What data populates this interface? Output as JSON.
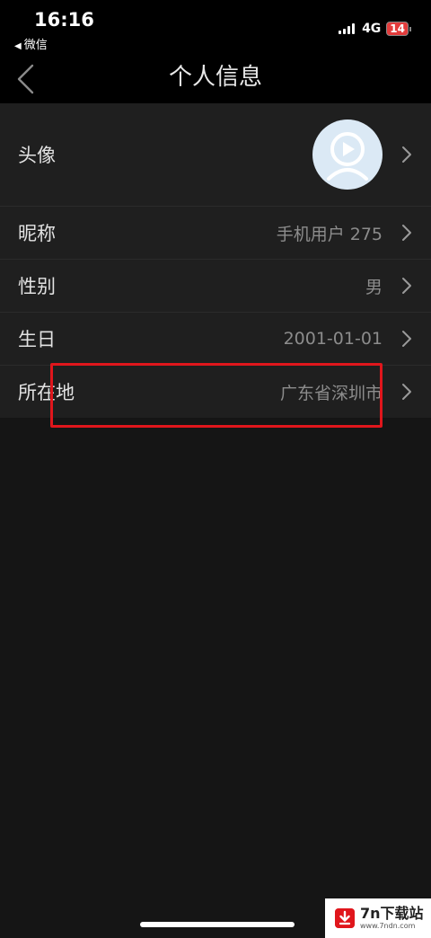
{
  "status_bar": {
    "time": "16:16",
    "back_app": "微信",
    "network": "4G",
    "battery": "14"
  },
  "nav": {
    "title": "个人信息"
  },
  "profile": {
    "avatar_label": "头像",
    "nickname_label": "昵称",
    "nickname_value": "手机用户 275",
    "gender_label": "性别",
    "gender_value": "男",
    "birthday_label": "生日",
    "birthday_value": "2001-01-01",
    "location_label": "所在地",
    "location_value": "广东省深圳市"
  },
  "colors": {
    "highlight": "#e0161c",
    "avatar_bg": "#dbe9f5"
  },
  "watermark": {
    "main": "7n下载站",
    "sub": "www.7ndn.com"
  }
}
